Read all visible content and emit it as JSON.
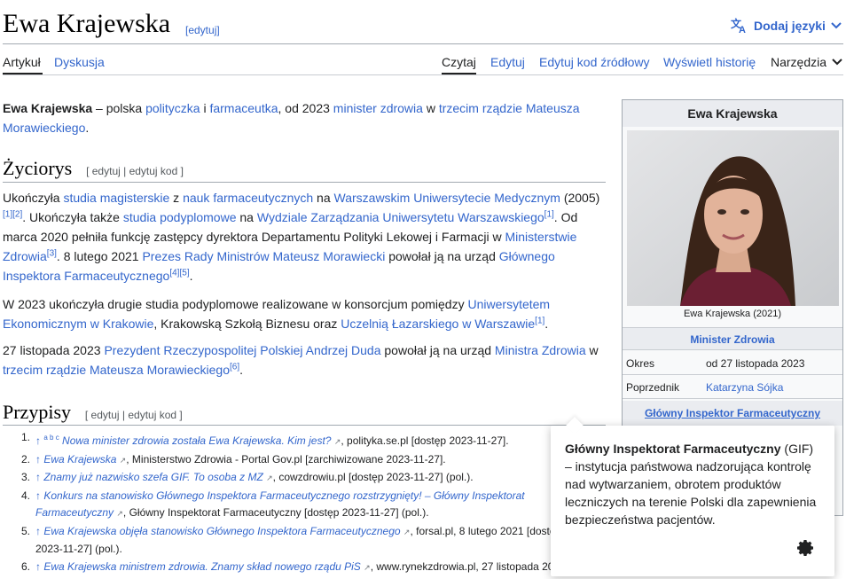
{
  "header": {
    "title": "Ewa Krajewska",
    "title_edit": "[edytuj]",
    "lang_button": "Dodaj języki"
  },
  "tabs": {
    "article": "Artykuł",
    "discussion": "Dyskusja",
    "read": "Czytaj",
    "edit": "Edytuj",
    "edit_source": "Edytuj kod źródłowy",
    "history": "Wyświetl historię",
    "tools": "Narzędzia"
  },
  "intro": {
    "name": "Ewa Krajewska",
    "t1": " – polska ",
    "l1": "polityczka",
    "t2": " i ",
    "l2": "farmaceutka",
    "t3": ", od 2023 ",
    "l3": "minister zdrowia",
    "t4": " w ",
    "l4": "trzecim rządzie Mateusza Morawieckiego",
    "t5": "."
  },
  "section_bio": {
    "heading": "Życiorys",
    "edit_links": "[ edytuj | edytuj kod ]",
    "p1": {
      "a": "Ukończyła ",
      "b": "studia magisterskie",
      "c": " z ",
      "d": "nauk farmaceutycznych",
      "e": " na ",
      "f": "Warszawskim Uniwersytecie Medycznym",
      "g": " (2005)",
      "s1": "[1][2]",
      "h": ". Ukończyła także ",
      "i": "studia podyplomowe",
      "j": " na ",
      "k": "Wydziale Zarządzania Uniwersytetu Warszawskiego",
      "s2": "[1]",
      "l": ". Od marca 2020 pełniła funkcję zastępcy dyrektora Departamentu Polityki Lekowej i Farmacji w ",
      "m": "Ministerstwie Zdrowia",
      "s3": "[3]",
      "n": ". 8 lutego 2021 ",
      "o": "Prezes Rady Ministrów",
      "p": " ",
      "q": "Mateusz Morawiecki",
      "r": " powołał ją na urząd ",
      "s": "Głównego Inspektora Farmaceutycznego",
      "s4": "[4][5]",
      "t": "."
    },
    "p2": {
      "a": "W 2023 ukończyła drugie studia podyplomowe realizowane w konsorcjum pomiędzy ",
      "b": "Uniwersytetem Ekonomicznym w Krakowie",
      "c": ", Krakowską Szkołą Biznesu oraz ",
      "d": "Uczelnią Łazarskiego w Warszawie",
      "s1": "[1]",
      "e": "."
    },
    "p3": {
      "a": "27 listopada 2023 ",
      "b": "Prezydent Rzeczypospolitej Polskiej",
      "c": " ",
      "d": "Andrzej Duda",
      "e": " powołał ją na urząd ",
      "f": "Ministra Zdrowia",
      "g": " w ",
      "h": "trzecim rządzie Mateusza Morawieckiego",
      "s1": "[6]",
      "i": "."
    }
  },
  "section_refs": {
    "heading": "Przypisy",
    "edit_links": "[ edytuj | edytuj kod ]",
    "items": [
      {
        "num": "1.",
        "arrow": "↑",
        "letters": "a b c",
        "title": "Nowa minister zdrowia została Ewa Krajewska. Kim jest?",
        "rest": ", polityka.se.pl [dostęp 2023-11-27]."
      },
      {
        "num": "2.",
        "arrow": "↑",
        "letters": "",
        "title": "Ewa Krajewska",
        "rest": ", Ministerstwo Zdrowia - Portal Gov.pl [zarchiwizowane 2023-11-27]."
      },
      {
        "num": "3.",
        "arrow": "↑",
        "letters": "",
        "title": "Znamy już nazwisko szefa GIF. To osoba z MZ",
        "rest": ", cowzdrowiu.pl [dostęp 2023-11-27] (pol.)."
      },
      {
        "num": "4.",
        "arrow": "↑",
        "letters": "",
        "title": "Konkurs na stanowisko Głównego Inspektora Farmaceutycznego rozstrzygnięty! – Główny Inspektorat Farmaceutyczny",
        "rest": ", Główny Inspektorat Farmaceutyczny [dostęp 2023-11-27] (pol.)."
      },
      {
        "num": "5.",
        "arrow": "↑",
        "letters": "",
        "title": "Ewa Krajewska objęła stanowisko Głównego Inspektora Farmaceutycznego",
        "rest": ", forsal.pl, 8 lutego 2021 [dostęp 2023-11-27] (pol.)."
      },
      {
        "num": "6.",
        "arrow": "↑",
        "letters": "",
        "title": "Ewa Krajewska ministrem zdrowia. Znamy skład nowego rządu PiS",
        "rest": ", www.rynekzdrowia.pl, 27 listopada 20"
      }
    ]
  },
  "infobox": {
    "name": "Ewa Krajewska",
    "caption": "Ewa Krajewska (2021)",
    "role": "Minister Zdrowia",
    "rows": [
      {
        "k": "Okres",
        "v": "od 27 listopada 2023"
      },
      {
        "k": "Poprzednik",
        "v": "Katarzyna Sójka"
      }
    ],
    "link": "Główny Inspektor Farmaceutyczny"
  },
  "popup": {
    "bold": "Główny Inspektorat Farmaceutyczny",
    "text": " (GIF) – instytucja państwowa nadzorująca kontrolę nad wytwarzaniem, obrotem produktów leczniczych na terenie Polski dla zapewnienia bezpieczeństwa pacjentów."
  },
  "icons": {
    "lang": "translate-icon",
    "chevron": "chevron-down-icon",
    "external": "external-link-icon",
    "gear": "gear-icon"
  },
  "colors": {
    "link": "#3366cc",
    "text": "#202122",
    "rule": "#a2a9b1"
  }
}
